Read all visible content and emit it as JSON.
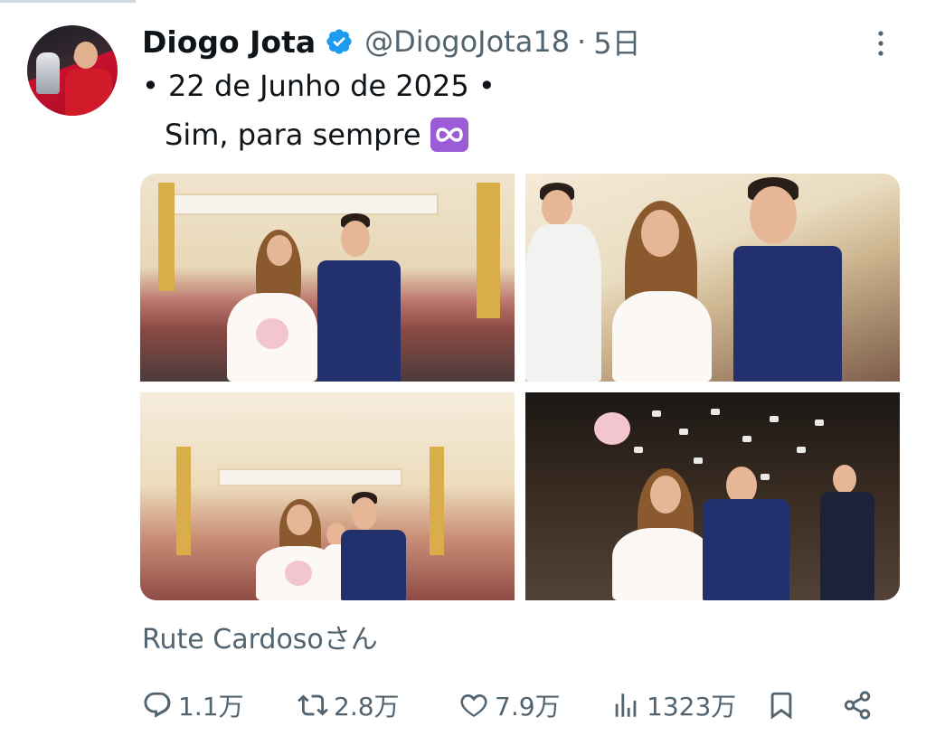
{
  "tweet": {
    "author": {
      "display_name": "Diogo Jota",
      "handle": "@DiogoJota18",
      "verified": true
    },
    "separator": "·",
    "time": "5日",
    "text_line1": "• 22 de Junho de 2025 •",
    "text_line2": "Sim, para sempre",
    "emoji": "infinity-emoji",
    "media": [
      {
        "name": "photo-wedding-altar"
      },
      {
        "name": "photo-wedding-applause"
      },
      {
        "name": "photo-wedding-family"
      },
      {
        "name": "photo-wedding-confetti"
      }
    ],
    "tagged": "Rute Cardosoさん",
    "actions": {
      "replies": "1.1万",
      "reposts": "2.8万",
      "likes": "7.9万",
      "views": "1323万"
    }
  },
  "colors": {
    "text": "#0f1419",
    "secondary": "#536471",
    "verified_blue": "#1d9bf0",
    "emoji_purple": "#9b5cd6"
  }
}
